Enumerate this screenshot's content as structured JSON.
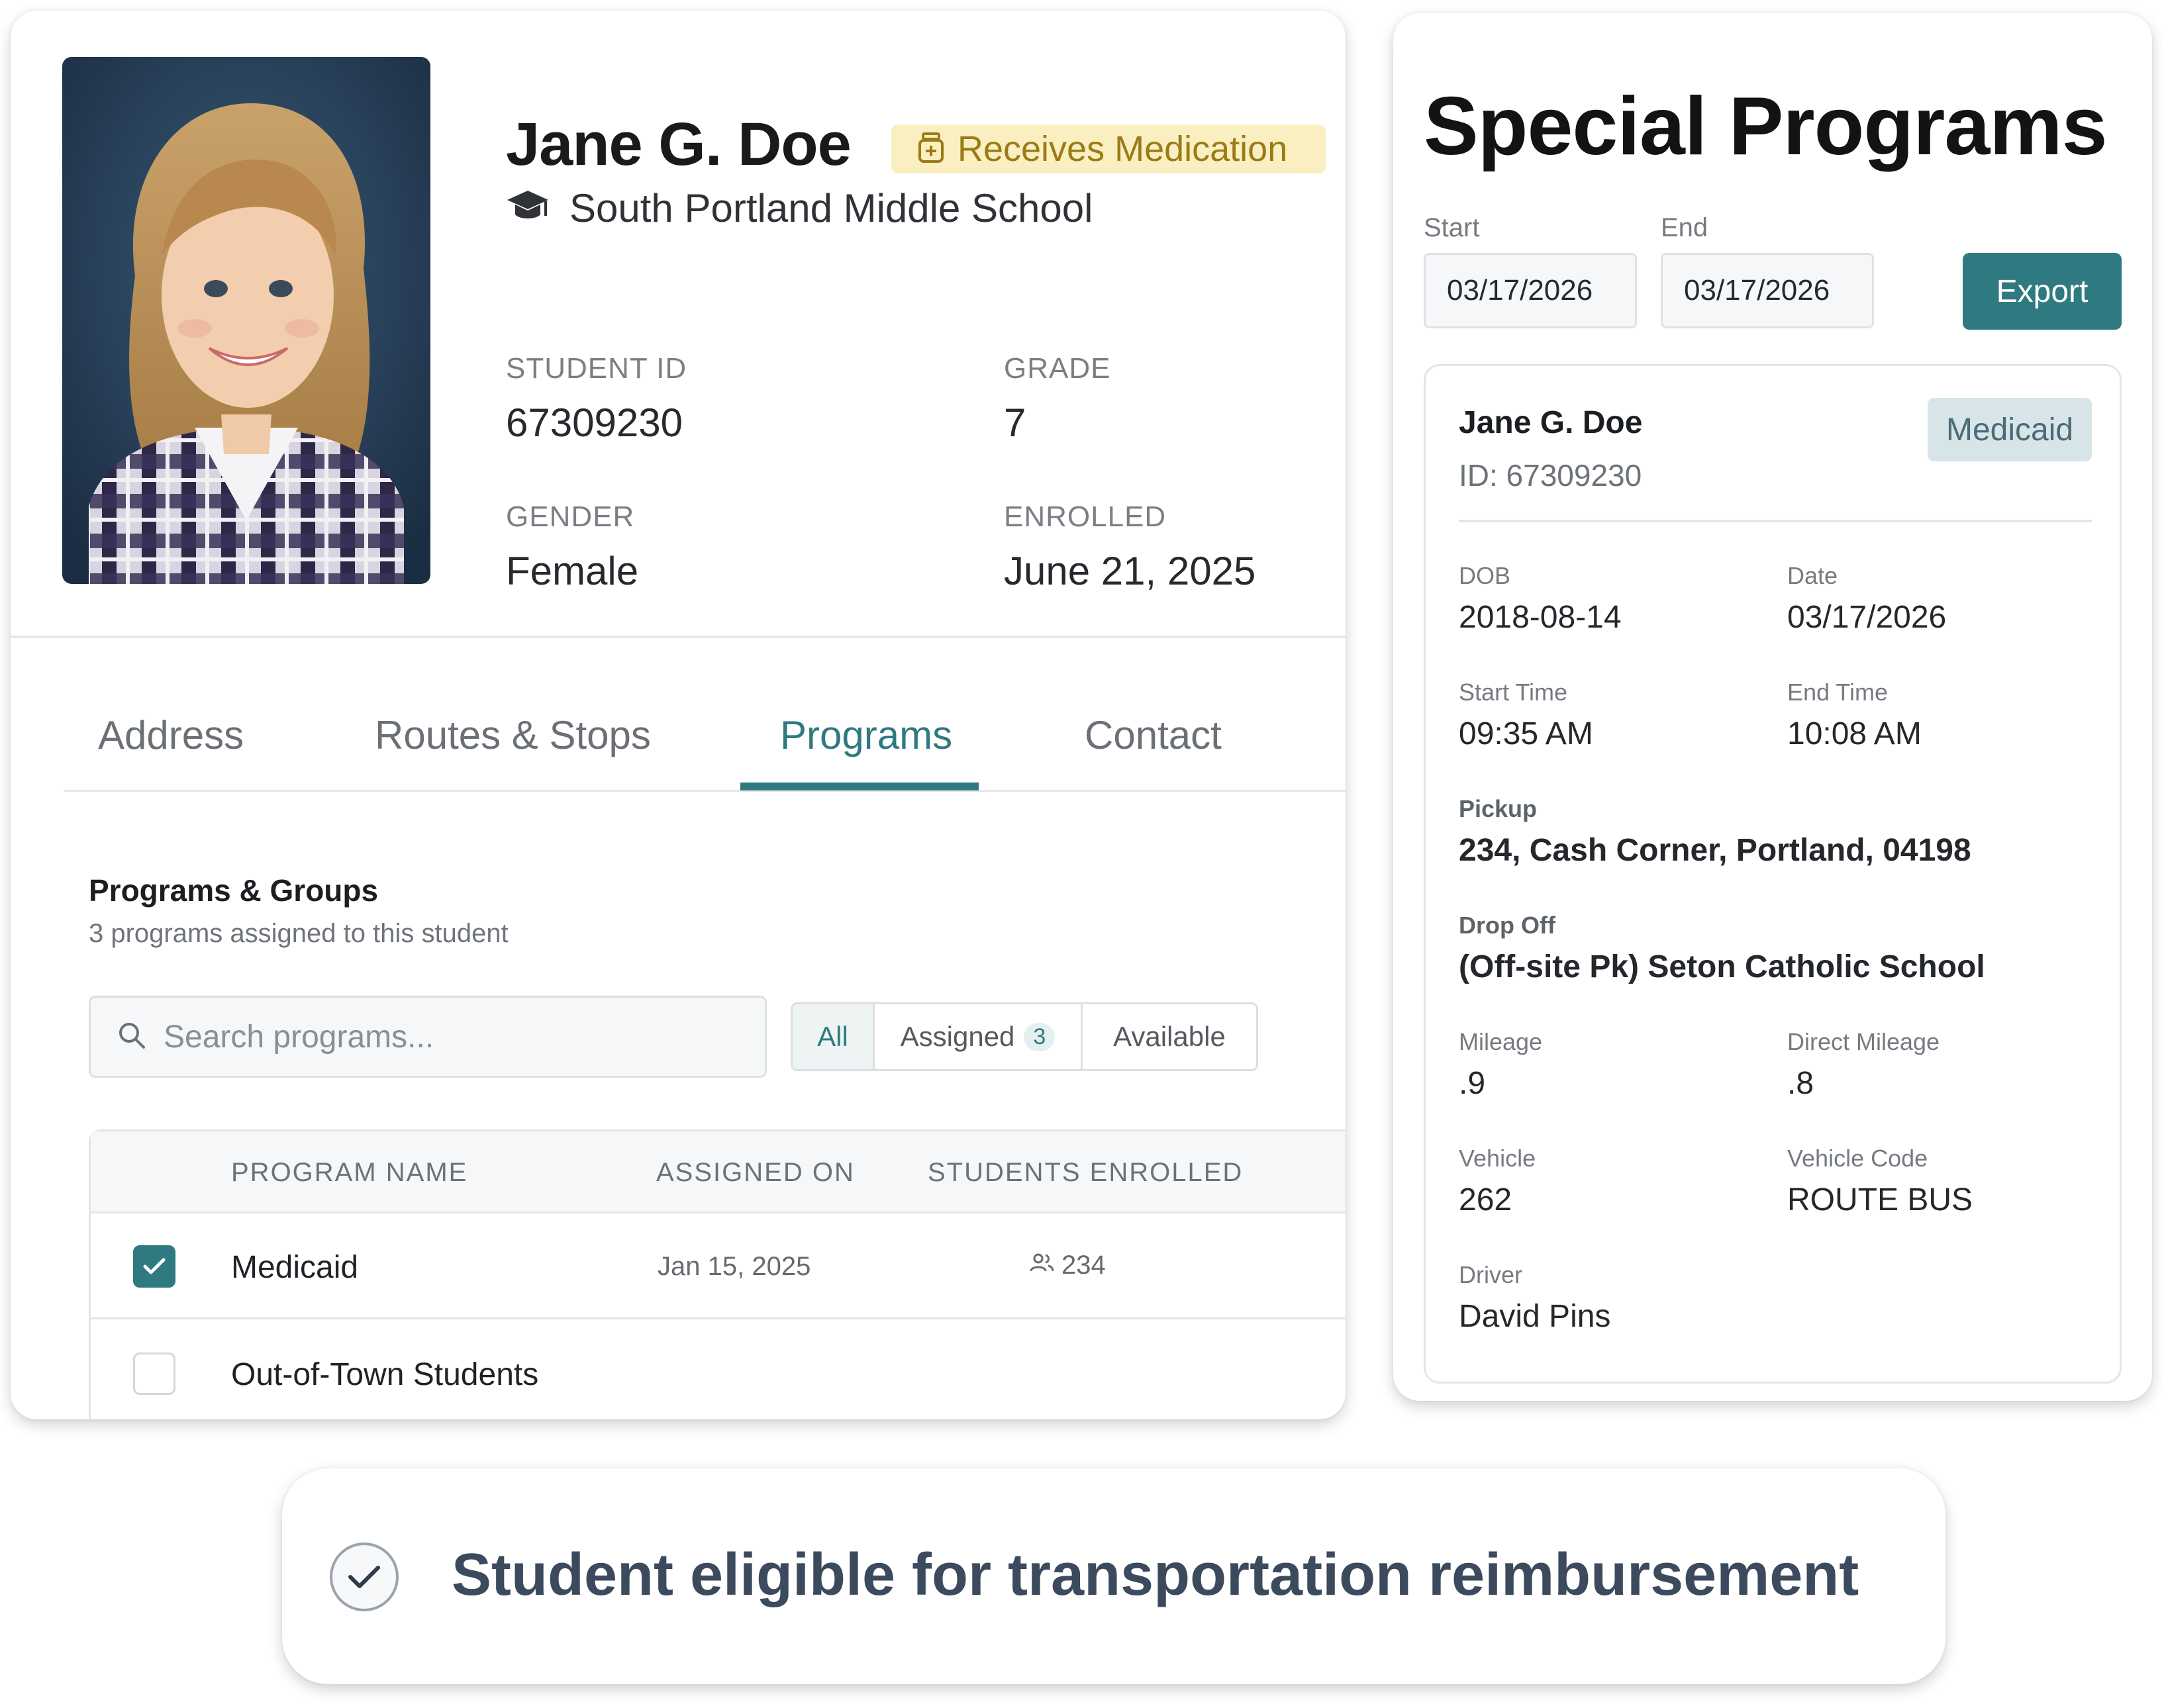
{
  "profile": {
    "name": "Jane G. Doe",
    "badge": "Receives Medication",
    "school": "South Portland Middle School",
    "fields": {
      "student_id_label": "STUDENT ID",
      "student_id": "67309230",
      "grade_label": "GRADE",
      "grade": "7",
      "gender_label": "GENDER",
      "gender": "Female",
      "enrolled_label": "ENROLLED",
      "enrolled": "June 21, 2025"
    }
  },
  "tabs": [
    {
      "label": "Address"
    },
    {
      "label": "Routes & Stops"
    },
    {
      "label": "Programs"
    },
    {
      "label": "Contact"
    }
  ],
  "active_tab": "Programs",
  "programs_section": {
    "title": "Programs & Groups",
    "subtitle": "3 programs assigned to this student",
    "search_placeholder": "Search programs...",
    "filters": {
      "all": "All",
      "assigned": "Assigned",
      "assigned_count": "3",
      "available": "Available"
    },
    "table": {
      "headers": {
        "name": "PROGRAM NAME",
        "assigned_on": "ASSIGNED ON",
        "enrolled": "STUDENTS ENROLLED"
      },
      "rows": [
        {
          "name": "Medicaid",
          "assigned_on": "Jan 15, 2025",
          "enrolled": "234",
          "checked": true
        },
        {
          "name": "Out-of-Town Students",
          "assigned_on": "",
          "enrolled": "",
          "checked": false
        }
      ]
    }
  },
  "special_programs": {
    "title": "Special Programs",
    "start_label": "Start",
    "start_value": "03/17/2026",
    "end_label": "End",
    "end_value": "03/17/2026",
    "export_label": "Export",
    "trip": {
      "name": "Jane G. Doe",
      "id": "ID: 67309230",
      "badge": "Medicaid",
      "dob_label": "DOB",
      "dob": "2018-08-14",
      "date_label": "Date",
      "date": "03/17/2026",
      "start_time_label": "Start Time",
      "start_time": "09:35 AM",
      "end_time_label": "End Time",
      "end_time": "10:08 AM",
      "pickup_label": "Pickup",
      "pickup": "234, Cash Corner, Portland, 04198",
      "dropoff_label": "Drop Off",
      "dropoff": "(Off-site Pk) Seton Catholic School",
      "mileage_label": "Mileage",
      "mileage": ".9",
      "direct_mileage_label": "Direct Mileage",
      "direct_mileage": ".8",
      "vehicle_label": "Vehicle",
      "vehicle": "262",
      "vehicle_code_label": "Vehicle Code",
      "vehicle_code": "ROUTE BUS",
      "driver_label": "Driver",
      "driver": "David Pins"
    }
  },
  "banner": {
    "text": "Student eligible for transportation reimbursement"
  },
  "colors": {
    "accent": "#2f7a80",
    "badge_bg": "#faefc0",
    "badge_text": "#9a7b16",
    "banner_text": "#3b4a5c"
  }
}
